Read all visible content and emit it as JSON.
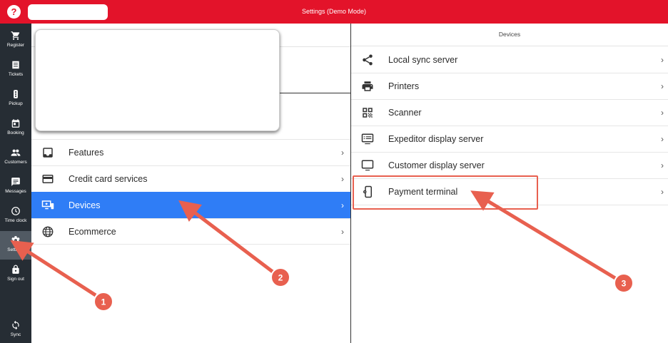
{
  "app": {
    "title": "Settings  (Demo Mode)",
    "help_glyph": "?"
  },
  "colors": {
    "brand": "#e3132a",
    "active_row": "#2f7df6",
    "sidebar": "#262d34",
    "annotation": "#e8604f"
  },
  "sidebar": {
    "items": [
      {
        "label": "Register",
        "icon": "cart-icon"
      },
      {
        "label": "Tickets",
        "icon": "list-icon"
      },
      {
        "label": "Pickup",
        "icon": "traffic-light-icon"
      },
      {
        "label": "Booking",
        "icon": "calendar-icon"
      },
      {
        "label": "Customers",
        "icon": "people-icon"
      },
      {
        "label": "Messages",
        "icon": "message-icon"
      },
      {
        "label": "Time clock",
        "icon": "clock-icon"
      },
      {
        "label": "Settings",
        "icon": "gear-icon",
        "active": true
      },
      {
        "label": "Sign out",
        "icon": "lock-icon"
      },
      {
        "label": "Sync",
        "icon": "sync-icon"
      }
    ]
  },
  "left": {
    "items": [
      {
        "label": "Features",
        "icon": "inbox-icon"
      },
      {
        "label": "Credit card services",
        "icon": "credit-card-icon"
      },
      {
        "label": "Devices",
        "icon": "devices-icon",
        "active": true
      },
      {
        "label": "Ecommerce",
        "icon": "globe-icon"
      }
    ]
  },
  "right": {
    "header": "Devices",
    "items": [
      {
        "label": "Local sync server",
        "icon": "share-icon"
      },
      {
        "label": "Printers",
        "icon": "printer-icon"
      },
      {
        "label": "Scanner",
        "icon": "qr-code-icon"
      },
      {
        "label": "Expeditor display server",
        "icon": "display-server-icon"
      },
      {
        "label": "Customer display server",
        "icon": "monitor-icon"
      },
      {
        "label": "Payment terminal",
        "icon": "payment-terminal-icon"
      }
    ]
  },
  "annotations": {
    "callouts": [
      "1",
      "2",
      "3"
    ]
  },
  "chevron": "›"
}
